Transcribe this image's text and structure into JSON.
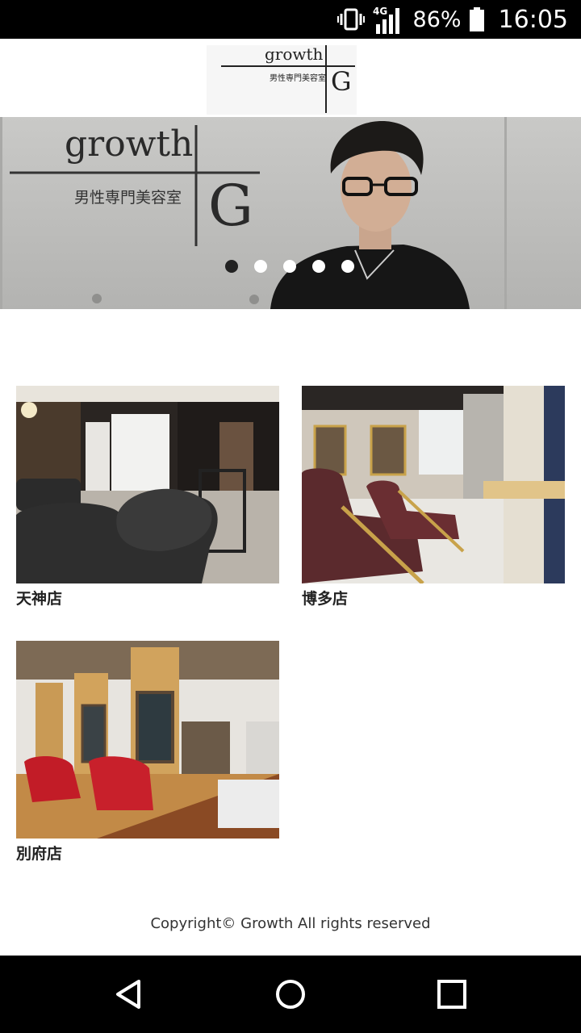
{
  "status_bar": {
    "network": "4G",
    "battery": "86%",
    "time": "16:05"
  },
  "header": {
    "logo_text": "growth",
    "logo_sub": "男性専門美容室",
    "logo_mark": "G"
  },
  "hero": {
    "logo_text": "growth",
    "logo_sub": "男性専門美容室",
    "logo_mark": "G",
    "slides": 5,
    "active_slide": 1
  },
  "stores": [
    {
      "name": "天神店"
    },
    {
      "name": "博多店"
    },
    {
      "name": "別府店"
    }
  ],
  "footer": {
    "copyright": "Copyright© Growth All rights reserved"
  },
  "nav_bar": {
    "icons": [
      "back-icon",
      "home-icon",
      "recents-icon"
    ]
  }
}
